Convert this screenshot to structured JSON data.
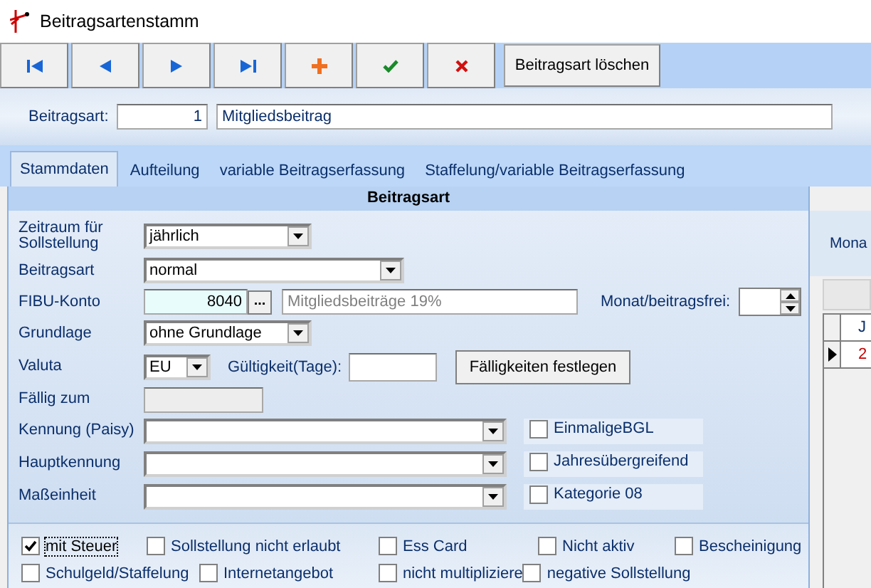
{
  "window": {
    "title": "Beitragsartenstamm"
  },
  "toolbar": {
    "buttons": [
      {
        "kind": "first"
      },
      {
        "kind": "prev"
      },
      {
        "kind": "next"
      },
      {
        "kind": "last"
      },
      {
        "kind": "add"
      },
      {
        "kind": "save"
      },
      {
        "kind": "cancel"
      }
    ],
    "delete_button": "Beitragsart löschen"
  },
  "header": {
    "label": "Beitragsart:",
    "number": "1",
    "name": "Mitgliedsbeitrag"
  },
  "tabs": [
    {
      "label": "Stammdaten",
      "selected": true
    },
    {
      "label": "Aufteilung",
      "selected": false
    },
    {
      "label": "variable Beitragserfassung",
      "selected": false
    },
    {
      "label": "Staffelung/variable Beitragserfassung",
      "selected": false
    }
  ],
  "panel_title": "Beitragsart",
  "form": {
    "zeitraum": {
      "label": "Zeitraum für Sollstellung",
      "value": "jährlich"
    },
    "beitragsart": {
      "label": "Beitragsart",
      "value": "normal"
    },
    "fibu": {
      "label": "FIBU-Konto",
      "value": "8040",
      "browse": "...",
      "description": "Mitgliedsbeiträge 19%",
      "month_label": "Monat/beitragsfrei:"
    },
    "grundlage": {
      "label": "Grundlage",
      "value": "ohne Grundlage"
    },
    "valuta": {
      "label": "Valuta",
      "value": "EU",
      "validity_label": "Gültigkeit(Tage):",
      "button": "Fälligkeiten festlegen"
    },
    "faellig": {
      "label": "Fällig zum"
    },
    "kennung": {
      "label": "Kennung (Paisy)"
    },
    "hauptkennung": {
      "label": "Hauptkennung"
    },
    "masseinheit": {
      "label": "Maßeinheit"
    }
  },
  "side_checkboxes": [
    {
      "label": "EinmaligeBGL",
      "checked": false
    },
    {
      "label": "Jahresübergreifend",
      "checked": false
    },
    {
      "label": "Kategorie 08",
      "checked": false
    }
  ],
  "bottom_checkboxes": [
    [
      {
        "label": "mit Steuer",
        "checked": true
      },
      {
        "label": "Sollstellung nicht erlaubt",
        "checked": false
      },
      {
        "label": "Ess Card",
        "checked": false
      },
      {
        "label": "Nicht aktiv",
        "checked": false
      },
      {
        "label": "Bescheinigung",
        "checked": false
      }
    ],
    [
      {
        "label": "Schulgeld/Staffelung",
        "checked": false
      },
      {
        "label": "Internetangebot",
        "checked": false
      },
      {
        "label": "nicht multipliziere",
        "checked": false
      },
      {
        "label": "negative Sollstellung",
        "checked": false
      }
    ]
  ],
  "side_panel": {
    "label": "Mona",
    "grid_header": "J",
    "grid_row": "2"
  }
}
